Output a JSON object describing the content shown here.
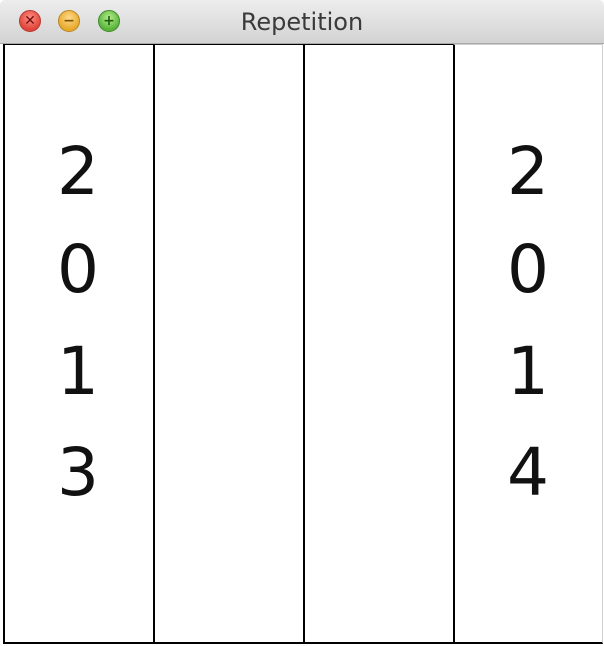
{
  "window": {
    "title": "Repetition",
    "controls": {
      "close_glyph": "✕",
      "minimize_glyph": "−",
      "maximize_glyph": "+"
    }
  },
  "columns": [
    {
      "digits": [
        "2",
        "0",
        "1",
        "3"
      ]
    },
    {
      "digits": []
    },
    {
      "digits": []
    },
    {
      "digits": [
        "2",
        "0",
        "1",
        "4"
      ]
    }
  ]
}
